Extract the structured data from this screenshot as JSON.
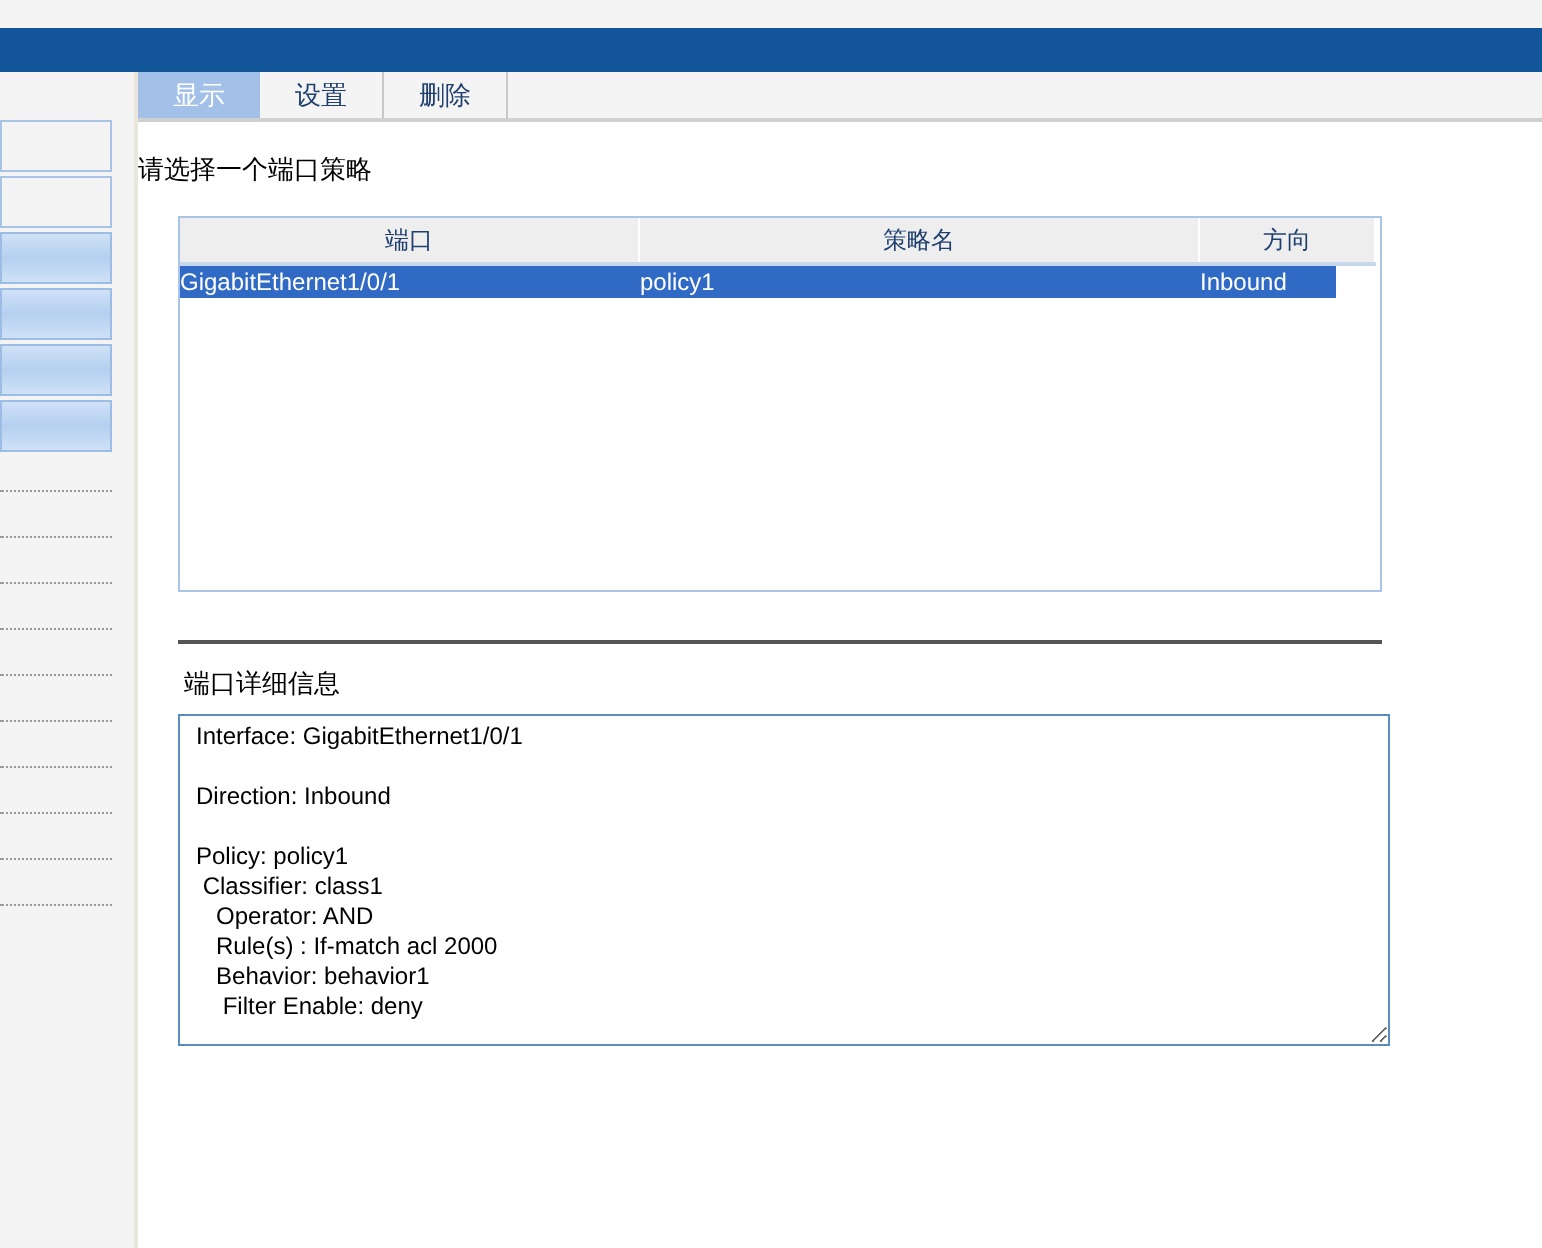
{
  "sidebar": {
    "buttons": [
      {
        "kind": "plain"
      },
      {
        "kind": "plain"
      },
      {
        "kind": "highlighted"
      },
      {
        "kind": "highlighted"
      },
      {
        "kind": "highlighted"
      },
      {
        "kind": "highlighted"
      }
    ]
  },
  "tabs": [
    {
      "label": "显示",
      "selected": true
    },
    {
      "label": "设置",
      "selected": false
    },
    {
      "label": "删除",
      "selected": false
    }
  ],
  "prompt": "请选择一个端口策略",
  "table": {
    "columns": [
      "端口",
      "策略名",
      "方向"
    ],
    "rows": [
      {
        "cells": [
          "GigabitEthernet1/0/1",
          "policy1",
          "Inbound"
        ],
        "selected": true
      }
    ]
  },
  "details": {
    "label": "端口详细信息",
    "value": "Interface: GigabitEthernet1/0/1\n\nDirection: Inbound\n\nPolicy: policy1\n Classifier: class1\n   Operator: AND\n   Rule(s) : If-match acl 2000\n   Behavior: behavior1\n    Filter Enable: deny"
  }
}
